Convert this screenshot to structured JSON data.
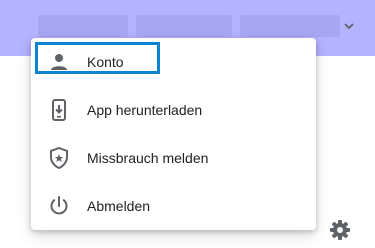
{
  "colors": {
    "header_bg": "#b4b3ff",
    "focus_ring": "#0a84ce",
    "icon": "#5f6368",
    "text": "#202124"
  },
  "header": {
    "account_name_redacted": true,
    "dropdown_icon": "chevron-down-icon"
  },
  "menu": {
    "items": [
      {
        "label": "Konto",
        "icon": "person-icon",
        "focused": true
      },
      {
        "label": "App herunterladen",
        "icon": "phone-download-icon",
        "focused": false
      },
      {
        "label": "Missbrauch melden",
        "icon": "shield-star-icon",
        "focused": false
      },
      {
        "label": "Abmelden",
        "icon": "power-icon",
        "focused": false
      }
    ]
  },
  "footer": {
    "settings_icon": "gear-icon"
  }
}
